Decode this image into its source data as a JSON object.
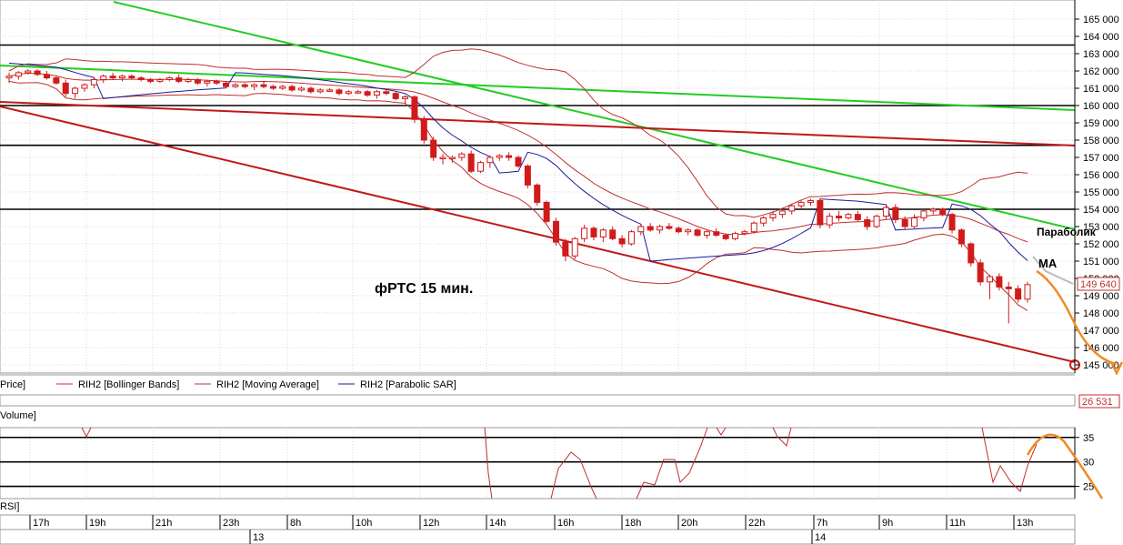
{
  "chart_data": {
    "type": "candlestick",
    "annotation_main": "фРТС   15 мин.",
    "label_parabolic": "Параболик",
    "label_ma": "MA",
    "last_price_label": "149 640",
    "volume_value_label": "26 531",
    "y_axis": {
      "min": 145000,
      "max": 165000,
      "ticks": [
        "165 000",
        "164 000",
        "163 000",
        "162 000",
        "161 000",
        "160 000",
        "159 000",
        "158 000",
        "157 000",
        "156 000",
        "155 000",
        "154 000",
        "153 000",
        "152 000",
        "151 000",
        "150 000",
        "149 000",
        "148 000",
        "147 000",
        "146 000",
        "145 000"
      ]
    },
    "time_ticks": [
      "17h",
      "19h",
      "21h",
      "23h",
      "8h",
      "10h",
      "12h",
      "14h",
      "16h",
      "18h",
      "20h",
      "22h",
      "7h",
      "9h",
      "11h",
      "13h"
    ],
    "date_labels": [
      "13",
      "14"
    ],
    "legend": {
      "price": "Price]",
      "bollinger": "RIH2 [Bollinger Bands]",
      "ma": "RIH2 [Moving Average]",
      "sar": "RIH2 [Parabolic SAR]"
    },
    "volume_panel_label": "Volume]",
    "rsi_panel_label": "RSI]",
    "rsi_axis": {
      "ticks": [
        "35",
        "30",
        "25"
      ],
      "levels": [
        35,
        30,
        25
      ]
    },
    "horizontal_levels": [
      163500,
      160000,
      157700,
      154000
    ],
    "candles": [
      [
        161600,
        161900,
        161300,
        161700
      ],
      [
        161700,
        162000,
        161500,
        161900
      ],
      [
        161900,
        162100,
        161800,
        162000
      ],
      [
        162000,
        162100,
        161700,
        161800
      ],
      [
        161800,
        162000,
        161500,
        161600
      ],
      [
        161600,
        161700,
        161200,
        161300
      ],
      [
        161300,
        161500,
        160500,
        160700
      ],
      [
        160700,
        161100,
        160400,
        161000
      ],
      [
        161000,
        161300,
        160800,
        161200
      ],
      [
        161200,
        161600,
        161000,
        161500
      ],
      [
        161500,
        161800,
        161300,
        161700
      ],
      [
        161700,
        161900,
        161500,
        161600
      ],
      [
        161600,
        161800,
        161400,
        161700
      ],
      [
        161700,
        161800,
        161500,
        161600
      ],
      [
        161600,
        161700,
        161400,
        161500
      ],
      [
        161500,
        161600,
        161300,
        161400
      ],
      [
        161400,
        161600,
        161300,
        161500
      ],
      [
        161500,
        161700,
        161400,
        161600
      ],
      [
        161600,
        161800,
        161300,
        161400
      ],
      [
        161400,
        161600,
        161300,
        161500
      ],
      [
        161500,
        161600,
        161200,
        161300
      ],
      [
        161300,
        161500,
        161100,
        161400
      ],
      [
        161400,
        161500,
        161200,
        161300
      ],
      [
        161300,
        161400,
        161000,
        161100
      ],
      [
        161100,
        161300,
        161000,
        161200
      ],
      [
        161200,
        161300,
        161000,
        161100
      ],
      [
        161100,
        161300,
        160900,
        161200
      ],
      [
        161200,
        161400,
        161000,
        161100
      ],
      [
        161100,
        161200,
        160900,
        161000
      ],
      [
        161000,
        161200,
        160900,
        161100
      ],
      [
        161100,
        161200,
        160800,
        160900
      ],
      [
        160900,
        161100,
        160800,
        161000
      ],
      [
        161000,
        161100,
        160700,
        160800
      ],
      [
        160800,
        161000,
        160700,
        160900
      ],
      [
        160900,
        161000,
        160800,
        160900
      ],
      [
        160900,
        161000,
        160600,
        160700
      ],
      [
        160700,
        160900,
        160600,
        160800
      ],
      [
        160800,
        160900,
        160700,
        160800
      ],
      [
        160800,
        160900,
        160500,
        160600
      ],
      [
        160600,
        160900,
        160400,
        160800
      ],
      [
        160800,
        160900,
        160600,
        160700
      ],
      [
        160700,
        160800,
        160300,
        160400
      ],
      [
        160400,
        160600,
        160100,
        160500
      ],
      [
        160500,
        160600,
        159000,
        159200
      ],
      [
        159200,
        159400,
        157800,
        158000
      ],
      [
        158000,
        158200,
        156800,
        157000
      ],
      [
        157000,
        157200,
        156600,
        157000
      ],
      [
        157000,
        157100,
        156700,
        157000
      ],
      [
        157000,
        157300,
        156800,
        157200
      ],
      [
        157200,
        157400,
        156100,
        156200
      ],
      [
        156200,
        156800,
        156100,
        156700
      ],
      [
        156700,
        157100,
        156400,
        157000
      ],
      [
        157000,
        157200,
        156800,
        157100
      ],
      [
        157100,
        157300,
        156800,
        157000
      ],
      [
        157000,
        157100,
        156400,
        156500
      ],
      [
        156500,
        156600,
        155200,
        155400
      ],
      [
        155400,
        155500,
        154200,
        154400
      ],
      [
        154400,
        154500,
        153200,
        153300
      ],
      [
        153300,
        153500,
        151900,
        152100
      ],
      [
        152100,
        152300,
        151000,
        151300
      ],
      [
        151300,
        152400,
        151100,
        152300
      ],
      [
        152300,
        153100,
        152100,
        152900
      ],
      [
        152900,
        153000,
        152200,
        152400
      ],
      [
        152400,
        152900,
        152100,
        152800
      ],
      [
        152800,
        153000,
        152200,
        152300
      ],
      [
        152300,
        152500,
        151800,
        152000
      ],
      [
        152000,
        152800,
        151900,
        152700
      ],
      [
        152700,
        153100,
        152500,
        153000
      ],
      [
        153000,
        153200,
        152700,
        152800
      ],
      [
        152800,
        153100,
        152600,
        153000
      ],
      [
        153000,
        153200,
        152800,
        152900
      ],
      [
        152900,
        153000,
        152600,
        152700
      ],
      [
        152700,
        152900,
        152500,
        152800
      ],
      [
        152800,
        152900,
        152400,
        152500
      ],
      [
        152500,
        152800,
        152300,
        152700
      ],
      [
        152700,
        152900,
        152400,
        152500
      ],
      [
        152500,
        152600,
        152200,
        152300
      ],
      [
        152300,
        152700,
        152200,
        152600
      ],
      [
        152600,
        152800,
        152500,
        152700
      ],
      [
        152700,
        153300,
        152600,
        153200
      ],
      [
        153200,
        153600,
        153000,
        153500
      ],
      [
        153500,
        153900,
        153300,
        153700
      ],
      [
        153700,
        154100,
        153500,
        153900
      ],
      [
        153900,
        154300,
        153700,
        154200
      ],
      [
        154200,
        154500,
        154000,
        154400
      ],
      [
        154400,
        154600,
        154200,
        154500
      ],
      [
        154500,
        154600,
        152900,
        153100
      ],
      [
        153100,
        153800,
        152900,
        153600
      ],
      [
        153600,
        153900,
        153300,
        153500
      ],
      [
        153500,
        153800,
        153400,
        153700
      ],
      [
        153700,
        153900,
        153300,
        153400
      ],
      [
        153400,
        153600,
        152800,
        153000
      ],
      [
        153000,
        153700,
        152900,
        153600
      ],
      [
        153600,
        154300,
        153400,
        154100
      ],
      [
        154100,
        154300,
        153200,
        153400
      ],
      [
        153400,
        153600,
        152800,
        153000
      ],
      [
        153000,
        153700,
        152900,
        153500
      ],
      [
        153500,
        154000,
        153300,
        153900
      ],
      [
        153900,
        154100,
        153700,
        154000
      ],
      [
        154000,
        154100,
        153600,
        153700
      ],
      [
        153700,
        153800,
        152600,
        152800
      ],
      [
        152800,
        152900,
        151800,
        152000
      ],
      [
        152000,
        152100,
        150700,
        150900
      ],
      [
        150900,
        151100,
        149600,
        149800
      ],
      [
        149800,
        150200,
        148800,
        150100
      ],
      [
        150100,
        150300,
        149300,
        149500
      ],
      [
        149500,
        149800,
        147400,
        149400
      ],
      [
        149400,
        149600,
        148600,
        148800
      ],
      [
        148800,
        149800,
        148600,
        149640
      ]
    ]
  }
}
